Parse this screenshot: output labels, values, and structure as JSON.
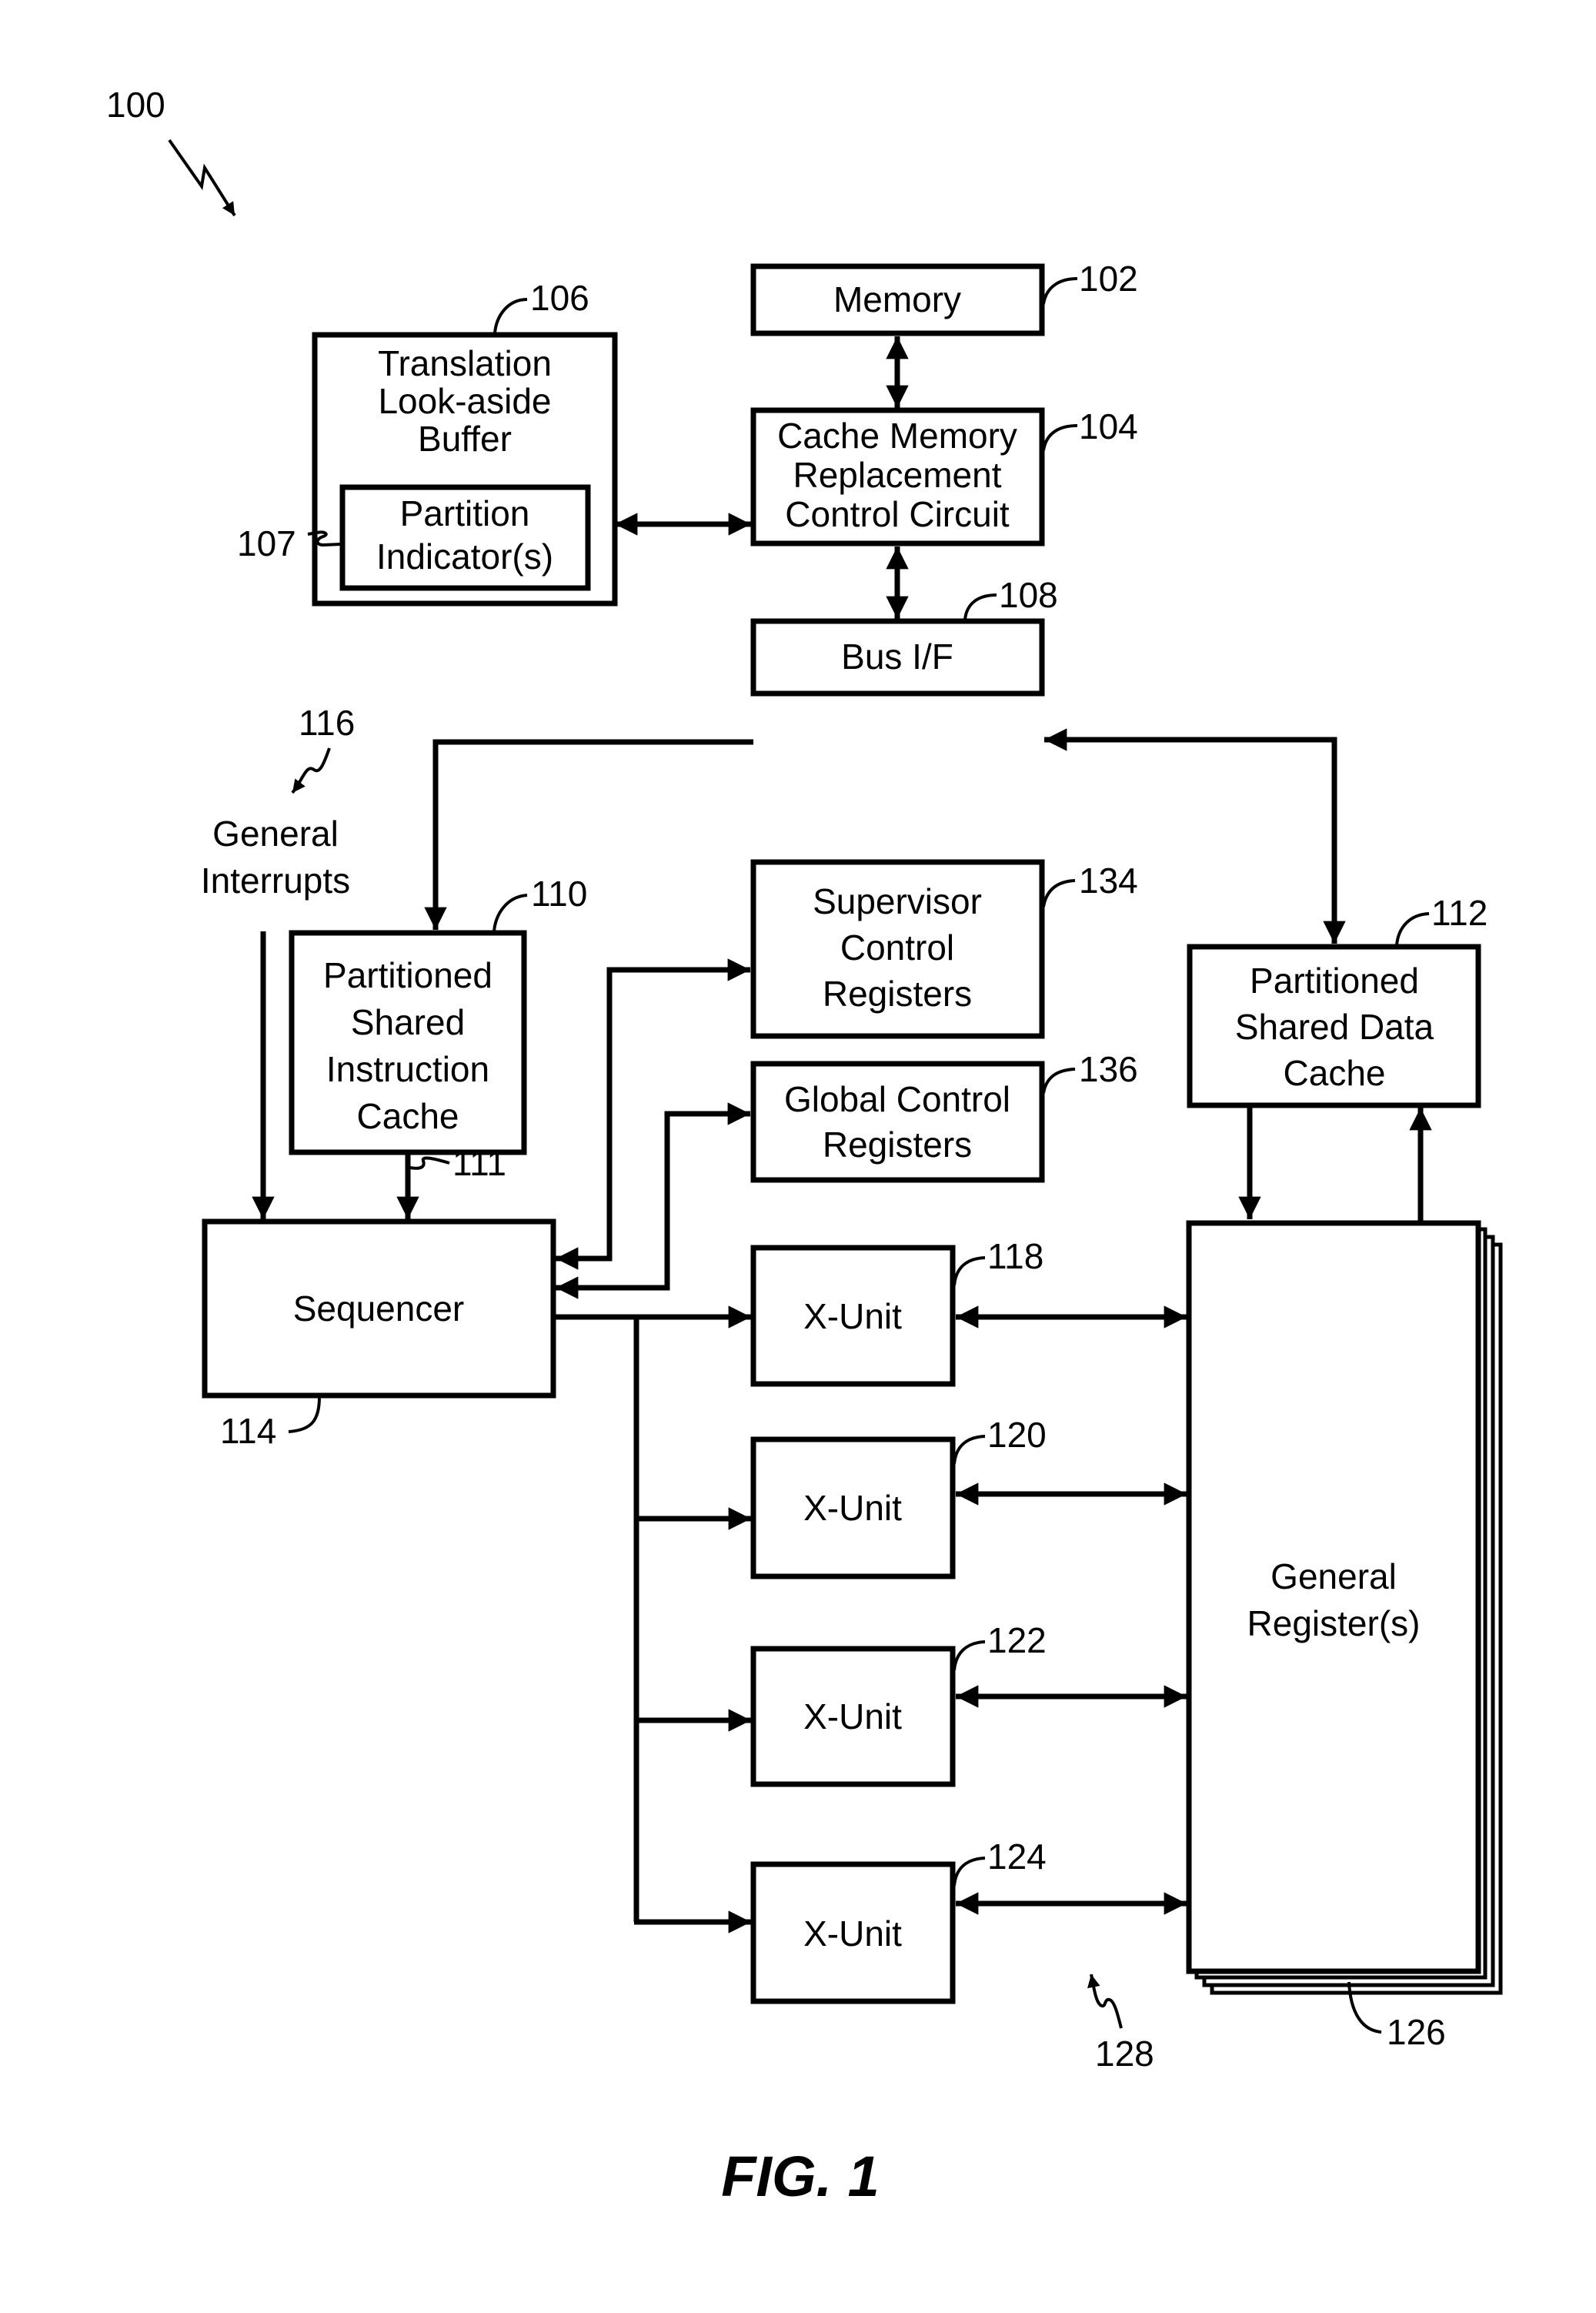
{
  "figure": {
    "caption": "FIG. 1",
    "system_ref": "100"
  },
  "blocks": {
    "memory": {
      "label": [
        "Memory"
      ],
      "ref": "102"
    },
    "cache_ctrl": {
      "label": [
        "Cache Memory",
        "Replacement",
        "Control Circuit"
      ],
      "ref": "104"
    },
    "tlb": {
      "label": [
        "Translation",
        "Look-aside",
        "Buffer"
      ],
      "ref": "106"
    },
    "partition_indicators": {
      "label": [
        "Partition",
        "Indicator(s)"
      ],
      "ref": "107"
    },
    "bus_if": {
      "label": [
        "Bus I/F"
      ],
      "ref": "108"
    },
    "instr_cache": {
      "label": [
        "Partitioned",
        "Shared",
        "Instruction",
        "Cache"
      ],
      "ref": "110"
    },
    "instr_path": {
      "ref": "111"
    },
    "data_cache": {
      "label": [
        "Partitioned",
        "Shared Data",
        "Cache"
      ],
      "ref": "112"
    },
    "sequencer": {
      "label": [
        "Sequencer"
      ],
      "ref": "114"
    },
    "interrupts": {
      "label": [
        "General",
        "Interrupts"
      ],
      "ref": "116"
    },
    "xunit1": {
      "label": [
        "X-Unit"
      ],
      "ref": "118"
    },
    "xunit2": {
      "label": [
        "X-Unit"
      ],
      "ref": "120"
    },
    "xunit3": {
      "label": [
        "X-Unit"
      ],
      "ref": "122"
    },
    "xunit4": {
      "label": [
        "X-Unit"
      ],
      "ref": "124"
    },
    "gen_regs": {
      "label": [
        "General",
        "Register(s)"
      ],
      "ref": "126"
    },
    "exec_units": {
      "ref": "128"
    },
    "supervisor_regs": {
      "label": [
        "Supervisor",
        "Control",
        "Registers"
      ],
      "ref": "134"
    },
    "global_regs": {
      "label": [
        "Global Control",
        "Registers"
      ],
      "ref": "136"
    }
  }
}
